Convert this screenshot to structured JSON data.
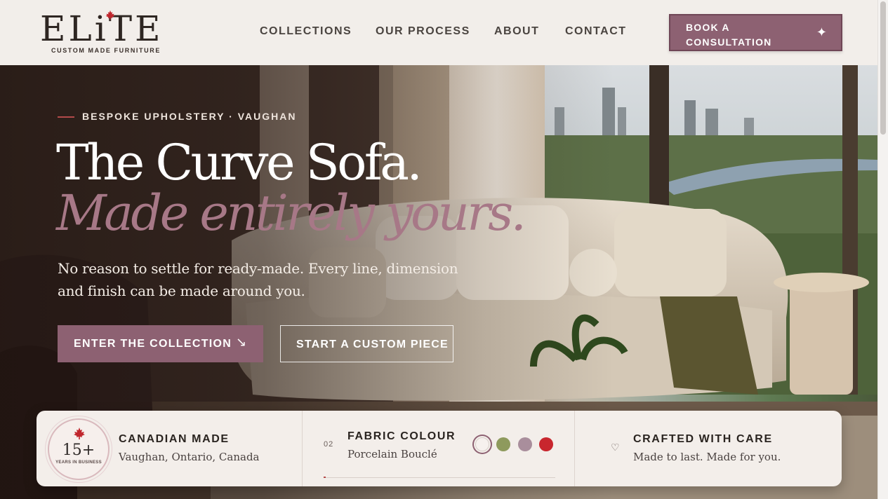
{
  "brand": {
    "logo_text": "ELiTE",
    "tagline": "CUSTOM MADE FURNITURE",
    "accent": "#8d6172",
    "maple_red": "#c0262d"
  },
  "nav": {
    "items": [
      "COLLECTIONS",
      "OUR PROCESS",
      "ABOUT",
      "CONTACT"
    ],
    "cta_label": "BOOK A CONSULTATION",
    "cta_icon": "sparkle-icon"
  },
  "hero": {
    "eyebrow": "BESPOKE UPHOLSTERY · VAUGHAN",
    "title": "The Curve Sofa.",
    "title_accent": "Made entirely yours.",
    "lead": "No reason to settle for ready-made. Every line, dimension and finish can be made around you.",
    "primary_label": "ENTER THE COLLECTION",
    "primary_icon": "↘",
    "secondary_label": "START A CUSTOM PIECE"
  },
  "panel": {
    "badge_number": "15+",
    "badge_text": "YEARS IN BUSINESS",
    "canadian_title": "CANADIAN MADE",
    "canadian_sub": "Vaughan, Ontario, Canada",
    "fabric_index": "02",
    "fabric_title": "FABRIC COLOUR",
    "fabric_sub": "Porcelain Bouclé",
    "fabric_progress": 0.01,
    "swatches": [
      {
        "name": "Porcelain",
        "color": "#f6f1ee",
        "selected": true
      },
      {
        "name": "Olive",
        "color": "#8e9a5d",
        "selected": false
      },
      {
        "name": "Mauve",
        "color": "#a98e9c",
        "selected": false
      },
      {
        "name": "Red",
        "color": "#c8262e",
        "selected": false
      }
    ],
    "care_title": "CRAFTED WITH CARE",
    "care_sub": "Made to last. Made for you.",
    "care_icon": "♡"
  }
}
